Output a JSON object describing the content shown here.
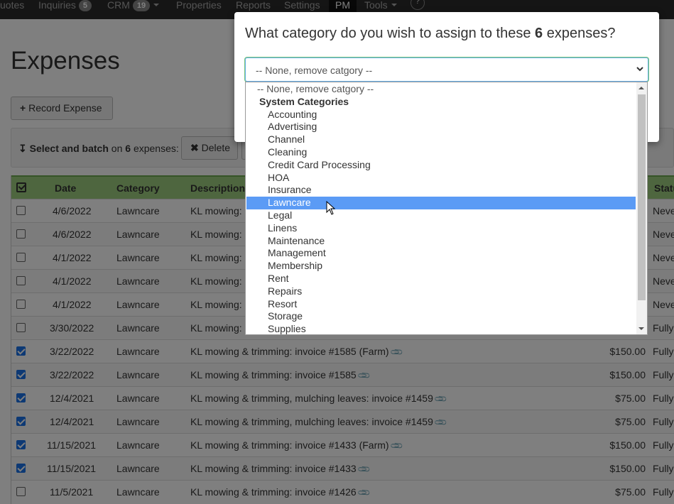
{
  "nav": {
    "items": [
      {
        "label": "uotes"
      },
      {
        "label": "Inquiries",
        "badge": "5"
      },
      {
        "label": "CRM",
        "badge": "19"
      },
      {
        "label": "Properties"
      },
      {
        "label": "Reports"
      },
      {
        "label": "Settings"
      },
      {
        "label": "PM"
      },
      {
        "label": "Tools"
      },
      {
        "label": "?"
      }
    ]
  },
  "page": {
    "title": "Expenses",
    "record_button": "Record Expense",
    "batch": {
      "prefix": "Select and batch",
      "on": "on",
      "count": "6",
      "suffix": "expenses:"
    },
    "delete_button": "Delete"
  },
  "table": {
    "headers": [
      "Date",
      "Category",
      "Description",
      "Statu"
    ],
    "rows": [
      {
        "checked": false,
        "date": "4/6/2022",
        "category": "Lawncare",
        "description": "KL mowing:",
        "amount": "",
        "status": "Neve"
      },
      {
        "checked": false,
        "date": "4/6/2022",
        "category": "Lawncare",
        "description": "KL mowing:",
        "amount": "",
        "status": "Neve"
      },
      {
        "checked": false,
        "date": "4/1/2022",
        "category": "Lawncare",
        "description": "KL mowing:",
        "amount": "",
        "status": "Neve"
      },
      {
        "checked": false,
        "date": "4/1/2022",
        "category": "Lawncare",
        "description": "KL mowing:",
        "amount": "",
        "status": "Neve"
      },
      {
        "checked": false,
        "date": "4/1/2022",
        "category": "Lawncare",
        "description": "KL mowing:",
        "amount": "",
        "status": "Neve"
      },
      {
        "checked": false,
        "date": "3/30/2022",
        "category": "Lawncare",
        "description": "KL mowing:",
        "amount": "",
        "status": "Fully"
      },
      {
        "checked": true,
        "date": "3/22/2022",
        "category": "Lawncare",
        "description": "KL mowing & trimming: invoice #1585 (Farm)",
        "amount": "$150.00",
        "status": "Fully"
      },
      {
        "checked": true,
        "date": "3/22/2022",
        "category": "Lawncare",
        "description": "KL mowing & trimming: invoice #1585",
        "amount": "$150.00",
        "status": "Fully"
      },
      {
        "checked": true,
        "date": "12/4/2021",
        "category": "Lawncare",
        "description": "KL mowing & trimming, mulching leaves: invoice #1459",
        "amount": "$75.00",
        "status": "Fully"
      },
      {
        "checked": true,
        "date": "12/4/2021",
        "category": "Lawncare",
        "description": "KL mowing & trimming, mulching leaves: invoice #1459",
        "amount": "$75.00",
        "status": "Fully"
      },
      {
        "checked": true,
        "date": "11/15/2021",
        "category": "Lawncare",
        "description": "KL mowing & trimming: invoice #1433 (Farm)",
        "amount": "$150.00",
        "status": "Fully"
      },
      {
        "checked": true,
        "date": "11/15/2021",
        "category": "Lawncare",
        "description": "KL mowing & trimming: invoice #1433",
        "amount": "$150.00",
        "status": "Fully"
      },
      {
        "checked": false,
        "date": "11/5/2021",
        "category": "Lawncare",
        "description": "KL mowing & trimming: invoice #1426",
        "amount": "$75.00",
        "status": "Fully"
      }
    ]
  },
  "modal": {
    "title_before": "What category do you wish to assign to these",
    "count": "6",
    "title_after": "expenses?",
    "select_value": "-- None, remove catgory --",
    "options": [
      {
        "label": "-- None, remove catgory --",
        "kind": "none"
      },
      {
        "label": "System Categories",
        "kind": "group"
      },
      {
        "label": "Accounting",
        "kind": "option"
      },
      {
        "label": "Advertising",
        "kind": "option"
      },
      {
        "label": "Channel",
        "kind": "option"
      },
      {
        "label": "Cleaning",
        "kind": "option"
      },
      {
        "label": "Credit Card Processing",
        "kind": "option"
      },
      {
        "label": "HOA",
        "kind": "option"
      },
      {
        "label": "Insurance",
        "kind": "option"
      },
      {
        "label": "Lawncare",
        "kind": "option",
        "selected": true
      },
      {
        "label": "Legal",
        "kind": "option"
      },
      {
        "label": "Linens",
        "kind": "option"
      },
      {
        "label": "Maintenance",
        "kind": "option"
      },
      {
        "label": "Management",
        "kind": "option"
      },
      {
        "label": "Membership",
        "kind": "option"
      },
      {
        "label": "Rent",
        "kind": "option"
      },
      {
        "label": "Repairs",
        "kind": "option"
      },
      {
        "label": "Resort",
        "kind": "option"
      },
      {
        "label": "Storage",
        "kind": "option"
      },
      {
        "label": "Supplies",
        "kind": "option"
      }
    ]
  },
  "colors": {
    "navbar": "#2b2b2b",
    "table_header": "#9ccc7e",
    "selected_option": "#5b9bf5",
    "checkbox_checked": "#1a73e8"
  }
}
